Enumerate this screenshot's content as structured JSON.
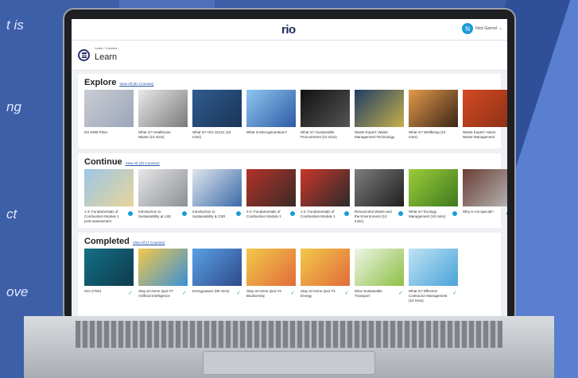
{
  "background": {
    "side_text": [
      "t is",
      "ng",
      "ct",
      "ove"
    ]
  },
  "app": {
    "logo": "rio",
    "user": {
      "initial": "N",
      "name": "Nick Garrod"
    }
  },
  "header": {
    "breadcrumb": "Learn / Courses",
    "title": "Learn"
  },
  "sections": [
    {
      "title": "Explore",
      "link": "View All (81 Courses)",
      "cards": [
        {
          "title": "DS 5499 Fibre",
          "thumb": [
            "#c9ccd3",
            "#9ca6b9"
          ]
        },
        {
          "title": "What Is? Healthcare Waste (10 mins)",
          "thumb": [
            "#e8e8e8",
            "#7a7a7a"
          ]
        },
        {
          "title": "What Is? ISO 20121 (10 mins)",
          "thumb": [
            "#2f5b8f",
            "#1b3558"
          ]
        },
        {
          "title": "What is Microgeneration?",
          "thumb": [
            "#8fc7ef",
            "#2e5aa6"
          ]
        },
        {
          "title": "What Is? Sustainable Procurement (10 mins)",
          "thumb": [
            "#111",
            "#555"
          ]
        },
        {
          "title": "Waste Expert: Waste Management Technology",
          "thumb": [
            "#1f3d66",
            "#c7b04a"
          ]
        },
        {
          "title": "What Is? Wellbeing (10 mins)",
          "thumb": [
            "#e49a4a",
            "#3a2418"
          ]
        },
        {
          "title": "Waste Expert: Hazar Waste Management",
          "thumb": [
            "#d44a22",
            "#8a2f16"
          ]
        }
      ]
    },
    {
      "title": "Continue",
      "link": "View All (32 Courses)",
      "cards": [
        {
          "title": "1-3: Fundamentals of Combustion Module 1 post-assessment",
          "thumb": [
            "#9cc6e6",
            "#e8d59a"
          ]
        },
        {
          "title": "Introduction to Sustainability at LSE",
          "thumb": [
            "#e6e6e6",
            "#8b8f95"
          ]
        },
        {
          "title": "Introduction to Sustainability & CSR",
          "thumb": [
            "#dfe6ee",
            "#3d6aa8"
          ]
        },
        {
          "title": "2-2: Fundamentals of Combustion Module 2",
          "thumb": [
            "#b3322a",
            "#3a2b25"
          ]
        },
        {
          "title": "1-2: Fundamentals of Combustion Module 1",
          "thumb": [
            "#c9362b",
            "#2b2b2b"
          ]
        },
        {
          "title": "Resourceful Waste and the Environment (10 mins)",
          "thumb": [
            "#7d7d7d",
            "#1f1f1f"
          ]
        },
        {
          "title": "What Is? Ecology Management (10 mins)",
          "thumb": [
            "#9ccc3a",
            "#3e7a1e"
          ]
        },
        {
          "title": "Why is AxI special?",
          "thumb": [
            "#6b3d34",
            "#b7b7b7"
          ]
        }
      ]
    },
    {
      "title": "Completed",
      "link": "View All (7 Courses)",
      "cards": [
        {
          "title": "ISO 27001",
          "thumb": [
            "#156f86",
            "#0d3c4b"
          ]
        },
        {
          "title": "Stay at Home Quiz #7 Artificial Intelligence",
          "thumb": [
            "#f2c94a",
            "#3a8fd6"
          ]
        },
        {
          "title": "Energyaware (90 mins)",
          "thumb": [
            "#5aa0e6",
            "#2e4a8a"
          ]
        },
        {
          "title": "Stay at Home Quiz #2 Biodiversity",
          "thumb": [
            "#f2c94a",
            "#e26b3a"
          ]
        },
        {
          "title": "Stay at Home Quiz #1 Energy",
          "thumb": [
            "#f2c94a",
            "#e26b3a"
          ]
        },
        {
          "title": "Wise Sustainable Transport",
          "thumb": [
            "#eef5e8",
            "#8cc043"
          ]
        },
        {
          "title": "What Is? Effective Contractor Management (10 mins)",
          "thumb": [
            "#bfe3f5",
            "#4aa3d8"
          ]
        }
      ]
    }
  ],
  "colors": {
    "accent": "#1a9bd7",
    "logo": "#1c2a5c",
    "page_bg": "#3d5fa8"
  }
}
